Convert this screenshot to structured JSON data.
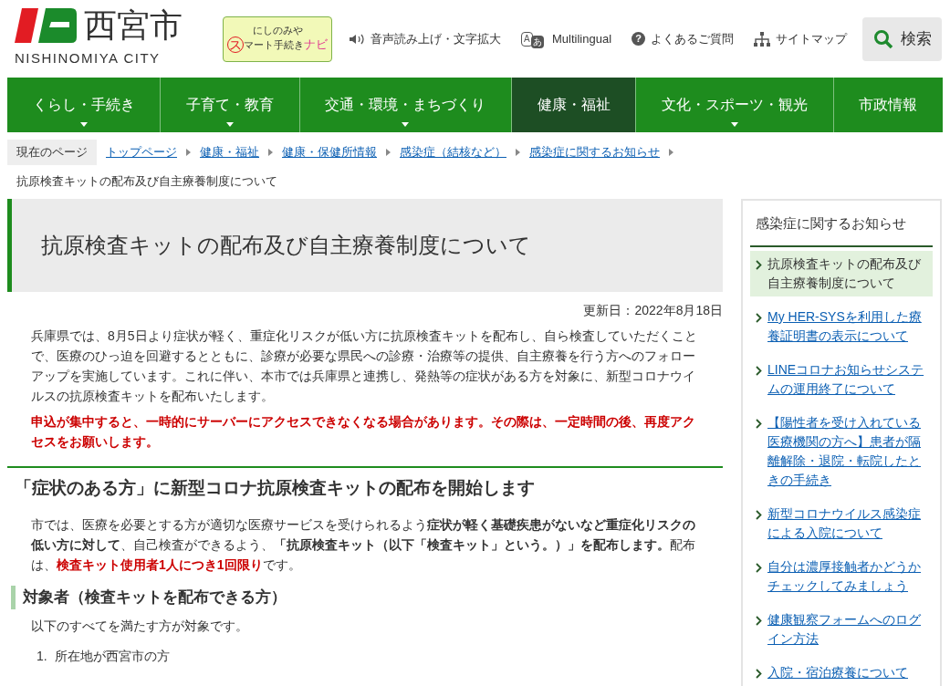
{
  "header": {
    "city_name": "西宮市",
    "city_roman": "NISHINOMIYA CITY",
    "navi_badge": {
      "top": "にしのみや",
      "initial": "ス",
      "rest": "マート手続き",
      "accent": "ナビ"
    },
    "utility_links": [
      {
        "kind": "speaker",
        "label": "音声読み上げ・文字拡大"
      },
      {
        "kind": "language",
        "label": "Multilingual",
        "icon_text": "A",
        "icon_text2": "あ"
      },
      {
        "kind": "help",
        "label": "よくあるご質問",
        "icon_text": "?"
      },
      {
        "kind": "sitemap",
        "label": "サイトマップ"
      }
    ],
    "search_button": "検索"
  },
  "nav": [
    {
      "label": "くらし・手続き",
      "selected": false,
      "has_menu": true
    },
    {
      "label": "子育て・教育",
      "selected": false,
      "has_menu": true
    },
    {
      "label": "交通・環境・まちづくり",
      "selected": false,
      "has_menu": true
    },
    {
      "label": "健康・福祉",
      "selected": true,
      "has_menu": false
    },
    {
      "label": "文化・スポーツ・観光",
      "selected": false,
      "has_menu": true
    },
    {
      "label": "市政情報",
      "selected": false,
      "has_menu": false
    }
  ],
  "breadcrumb": {
    "label": "現在のページ",
    "links": [
      "トップページ",
      "健康・福祉",
      "健康・保健所情報",
      "感染症（結核など）",
      "感染症に関するお知らせ"
    ],
    "current": "抗原検査キットの配布及び自主療養制度について"
  },
  "page": {
    "title": "抗原検査キットの配布及び自主療養制度について",
    "updated": "更新日：2022年8月18日",
    "intro": "兵庫県では、8月5日より症状が軽く、重症化リスクが低い方に抗原検査キットを配布し、自ら検査していただくことで、医療のひっ迫を回避するとともに、診療が必要な県民への診療・治療等の提供、自主療養を行う方へのフォローアップを実施しています。これに伴い、本市では兵庫県と連携し、発熱等の症状がある方を対象に、新型コロナウイルスの抗原検査キットを配布いたします。",
    "warning": "申込が集中すると、一時的にサーバーにアクセスできなくなる場合があります。その際は、一定時間の後、再度アクセスをお願いします。",
    "section_title": "「症状のある方」に新型コロナ抗原検査キットの配布を開始します",
    "section_body": [
      {
        "kind": "plain",
        "text": "市では、医療を必要とする方が適切な医療サービスを受けられるよう"
      },
      {
        "kind": "bold",
        "text": "症状が軽く基礎疾患がないなど重症化リスクの低い方に対して"
      },
      {
        "kind": "plain",
        "text": "、自己検査ができるよう、"
      },
      {
        "kind": "bold",
        "text": "「抗原検査キット（以下「検査キット」という。）」を配布します。"
      },
      {
        "kind": "plain",
        "text": "配布は、"
      },
      {
        "kind": "red",
        "text": "検査キット使用者1人につき1回限り"
      },
      {
        "kind": "plain",
        "text": "です。"
      }
    ],
    "subsection_title": "対象者（検査キットを配布できる方）",
    "subsection_body": "以下のすべてを満たす方が対象です。",
    "conditions": [
      {
        "number": "1.",
        "text": "所在地が西宮市の方"
      }
    ]
  },
  "sidebar": {
    "title": "感染症に関するお知らせ",
    "items": [
      {
        "label": "抗原検査キットの配布及び自主療養制度について",
        "selected": true
      },
      {
        "label": "My HER-SYSを利用した療養証明書の表示について",
        "selected": false
      },
      {
        "label": "LINEコロナお知らせシステムの運用終了について",
        "selected": false
      },
      {
        "label": "【陽性者を受け入れている医療機関の方へ】患者が隔離解除・退院・転院したときの手続き",
        "selected": false
      },
      {
        "label": "新型コロナウイルス感染症による入院について",
        "selected": false
      },
      {
        "label": "自分は濃厚接触者かどうかチェックしてみましょう",
        "selected": false
      },
      {
        "label": "健康観察フォームへのログイン方法",
        "selected": false
      },
      {
        "label": "入院・宿泊療養について",
        "selected": false
      }
    ]
  }
}
